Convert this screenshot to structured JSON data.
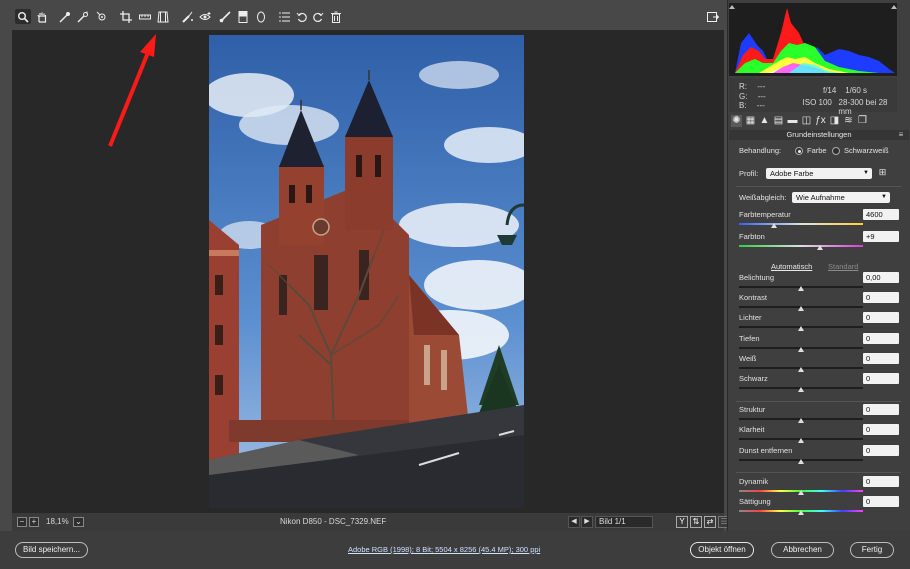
{
  "toolbar": {
    "tools": [
      "zoom-icon",
      "hand-icon",
      "white-balance-icon",
      "color-sampler-icon",
      "target-adjust-icon",
      "crop-icon",
      "straighten-icon",
      "transform-icon",
      "spot-removal-icon",
      "red-eye-icon",
      "adjustment-brush-icon",
      "graduated-filter-icon",
      "radial-filter-icon",
      "presets-icon",
      "rotate-left-icon",
      "rotate-right-icon",
      "trash-icon"
    ]
  },
  "histogram": {
    "rgb_labels": [
      "R:",
      "G:",
      "B:"
    ],
    "rgb_values": [
      "---",
      "---",
      "---"
    ],
    "aperture": "f/14",
    "shutter": "1/60 s",
    "iso": "ISO 100",
    "lens": "28-300 bei 28 mm"
  },
  "panel": {
    "section_title": "Grundeinstellungen",
    "treatment_label": "Behandlung:",
    "treatment_color": "Farbe",
    "treatment_bw": "Schwarzweiß",
    "profile_label": "Profil:",
    "profile_value": "Adobe Farbe",
    "wb_label": "Weißabgleich:",
    "wb_value": "Wie Aufnahme",
    "auto_link": "Automatisch",
    "default_link": "Standard",
    "sliders": [
      {
        "label": "Farbtemperatur",
        "value": "4600",
        "level": 0.28
      },
      {
        "label": "Farbton",
        "value": "+9",
        "level": 0.65
      },
      {
        "label": "Belichtung",
        "value": "0,00",
        "level": 0.5
      },
      {
        "label": "Kontrast",
        "value": "0",
        "level": 0.5
      },
      {
        "label": "Lichter",
        "value": "0",
        "level": 0.5
      },
      {
        "label": "Tiefen",
        "value": "0",
        "level": 0.5
      },
      {
        "label": "Weiß",
        "value": "0",
        "level": 0.5
      },
      {
        "label": "Schwarz",
        "value": "0",
        "level": 0.5
      },
      {
        "label": "Struktur",
        "value": "0",
        "level": 0.5
      },
      {
        "label": "Klarheit",
        "value": "0",
        "level": 0.5
      },
      {
        "label": "Dunst entfernen",
        "value": "0",
        "level": 0.5
      },
      {
        "label": "Dynamik",
        "value": "0",
        "level": 0.5
      },
      {
        "label": "Sättigung",
        "value": "0",
        "level": 0.5
      }
    ]
  },
  "canvasbar": {
    "zoom": "18,1%",
    "filename": "Nikon D850 - DSC_7329.NEF",
    "image_counter": "Bild 1/1",
    "view_y": "Y"
  },
  "bottom": {
    "save_button": "Bild speichern...",
    "workflow_info": "Adobe RGB (1998); 8 Bit; 5504 x 8256 (45.4 MP); 300 ppi",
    "open_button": "Objekt öffnen",
    "cancel_button": "Abbrechen",
    "done_button": "Fertig"
  },
  "colors": {
    "accent_arrow": "#ff1a1a",
    "panel_bg": "#3f3f3f",
    "canvas_bg": "#282828"
  }
}
